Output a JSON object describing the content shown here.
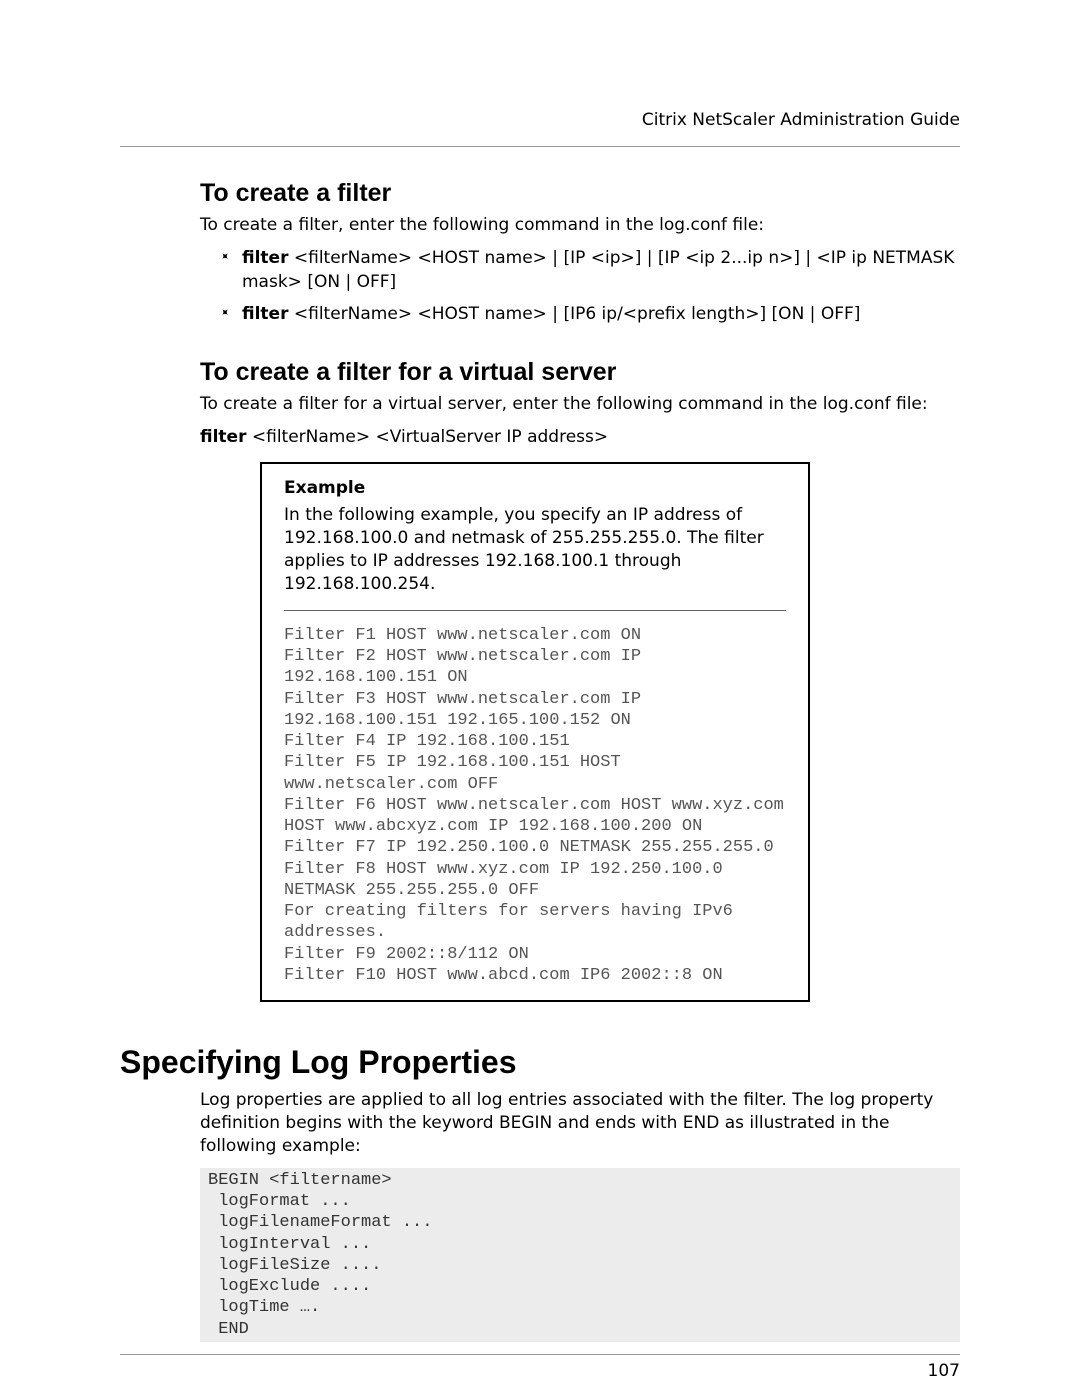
{
  "header": {
    "title": "Citrix NetScaler Administration Guide"
  },
  "section1": {
    "heading": "To create a filter",
    "intro": "To create a filter, enter the following command in the log.conf file:",
    "bullets": [
      {
        "bold": "filter",
        "rest": " <filterName> <HOST name> | [IP <ip>] | [IP <ip 2...ip n>] | <IP ip NETMASK mask> [ON | OFF]"
      },
      {
        "bold": "filter",
        "rest": " <filterName> <HOST name> | [IP6 ip/<prefix length>] [ON | OFF]"
      }
    ]
  },
  "section2": {
    "heading": "To create a filter for a virtual server",
    "intro": "To create a filter for a virtual server, enter the following command in the log.conf file:",
    "cmd_bold": "filter",
    "cmd_rest": " <filterName> <VirtualServer IP address>"
  },
  "example": {
    "label": "Example",
    "desc": "In the following example, you specify an IP address of 192.168.100.0 and netmask of 255.255.255.0. The filter applies to IP addresses 192.168.100.1 through 192.168.100.254.",
    "code": "Filter F1 HOST www.netscaler.com ON\nFilter F2 HOST www.netscaler.com IP 192.168.100.151 ON\nFilter F3 HOST www.netscaler.com IP 192.168.100.151 192.165.100.152 ON\nFilter F4 IP 192.168.100.151\nFilter F5 IP 192.168.100.151 HOST www.netscaler.com OFF\nFilter F6 HOST www.netscaler.com HOST www.xyz.com HOST www.abcxyz.com IP 192.168.100.200 ON\nFilter F7 IP 192.250.100.0 NETMASK 255.255.255.0\nFilter F8 HOST www.xyz.com IP 192.250.100.0 NETMASK 255.255.255.0 OFF\nFor creating filters for servers having IPv6 addresses.\nFilter F9 2002::8/112 ON\nFilter F10 HOST www.abcd.com IP6 2002::8 ON"
  },
  "main": {
    "heading": "Specifying Log Properties",
    "para": "Log properties are applied to all log entries associated with the filter. The log property definition begins with the keyword BEGIN and ends with END as illustrated in the following example:",
    "code": "BEGIN <filtername>\n logFormat ...\n logFilenameFormat ...\n logInterval ...\n logFileSize ....\n logExclude ....\n logTime ….\n END"
  },
  "footer": {
    "page": "107"
  }
}
